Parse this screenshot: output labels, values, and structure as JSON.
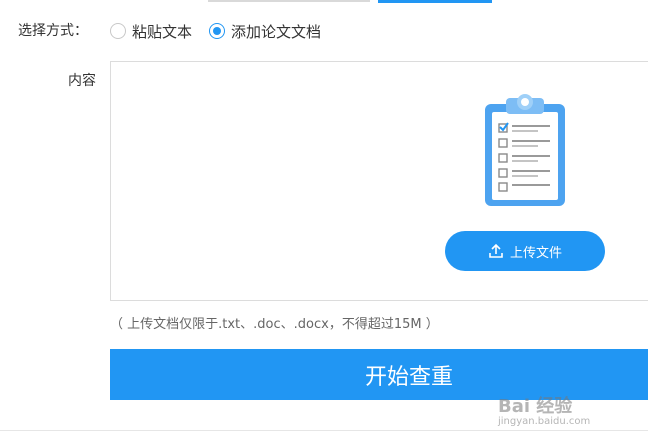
{
  "form": {
    "method_label": "选择方式：",
    "options": [
      {
        "label": "粘贴文本",
        "selected": false
      },
      {
        "label": "添加论文文档",
        "selected": true
      }
    ],
    "content_label": "内容",
    "upload_button": {
      "label": "上传文件",
      "icon": "upload-icon"
    },
    "upload_hint": "（ 上传文档仅限于.txt、.doc、.docx，不得超过15M ）",
    "start_button": "开始查重"
  },
  "watermark": {
    "main": "Bai 经验",
    "sub": "jingyan.baidu.com"
  },
  "colors": {
    "accent": "#2196f3",
    "border": "#dcdcdc",
    "text": "#333333"
  }
}
